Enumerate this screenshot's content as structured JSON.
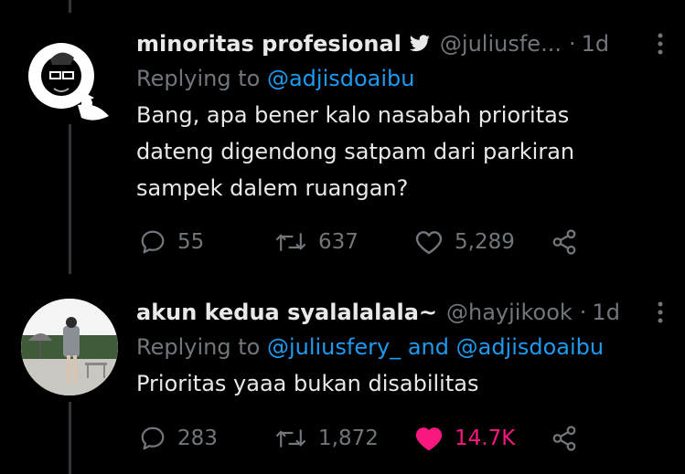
{
  "colors": {
    "background": "#000000",
    "text": "#e7e9ea",
    "muted": "#71767b",
    "link": "#1d9bf0",
    "like": "#f91880"
  },
  "tweets": [
    {
      "name": "minoritas profesional",
      "badge_icon": "twitter-bird-icon",
      "handle": "@juliusfe...",
      "dot": "·",
      "time": "1d",
      "replying_prefix": "Replying to",
      "mentions": [
        "@adjisdoaibu"
      ],
      "text": "Bang, apa bener kalo nasabah prioritas\ndateng digendong satpam dari parkiran\nsampek dalem ruangan?",
      "stats": {
        "replies": "55",
        "retweets": "637",
        "likes": "5,289"
      },
      "liked": false
    },
    {
      "name": "akun kedua syalalalala~",
      "handle": "@hayjikook",
      "dot": "·",
      "time": "1d",
      "replying_prefix": "Replying to",
      "mentions": [
        "@juliusfery_",
        "and",
        "@adjisdoaibu"
      ],
      "text": "Prioritas yaaa bukan disabilitas",
      "stats": {
        "replies": "283",
        "retweets": "1,872",
        "likes": "14.7K"
      },
      "liked": true
    }
  ]
}
